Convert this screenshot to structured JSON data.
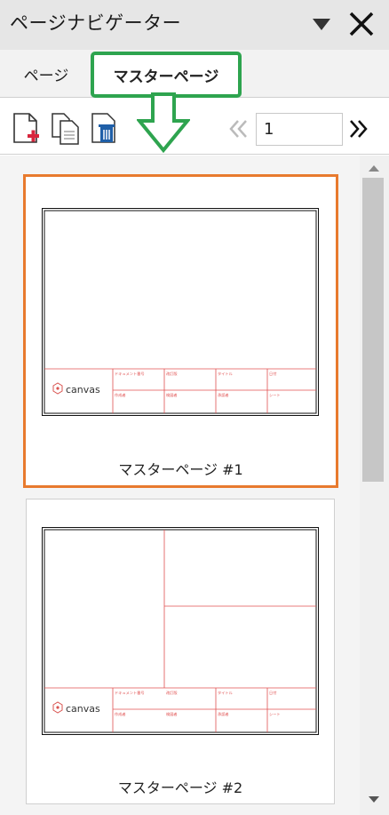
{
  "panel": {
    "title": "ページナビゲーター"
  },
  "tabs": [
    {
      "label": "ページ",
      "active": false
    },
    {
      "label": "マスターページ",
      "active": true
    }
  ],
  "toolbar": {
    "current_page": "1"
  },
  "thumbnails": [
    {
      "label": "マスターページ #1",
      "selected": true
    },
    {
      "label": "マスターページ #2",
      "selected": false
    }
  ],
  "title_block": {
    "logo_text": "canvas",
    "fields": [
      "ドキュメント番号",
      "改訂版",
      "タイトル",
      "日付",
      "作成者",
      "検図者",
      "承認者",
      "シート"
    ]
  },
  "colors": {
    "accent_green": "#2ea44f",
    "selection_orange": "#e87a2e",
    "title_block_red": "#e05050"
  }
}
